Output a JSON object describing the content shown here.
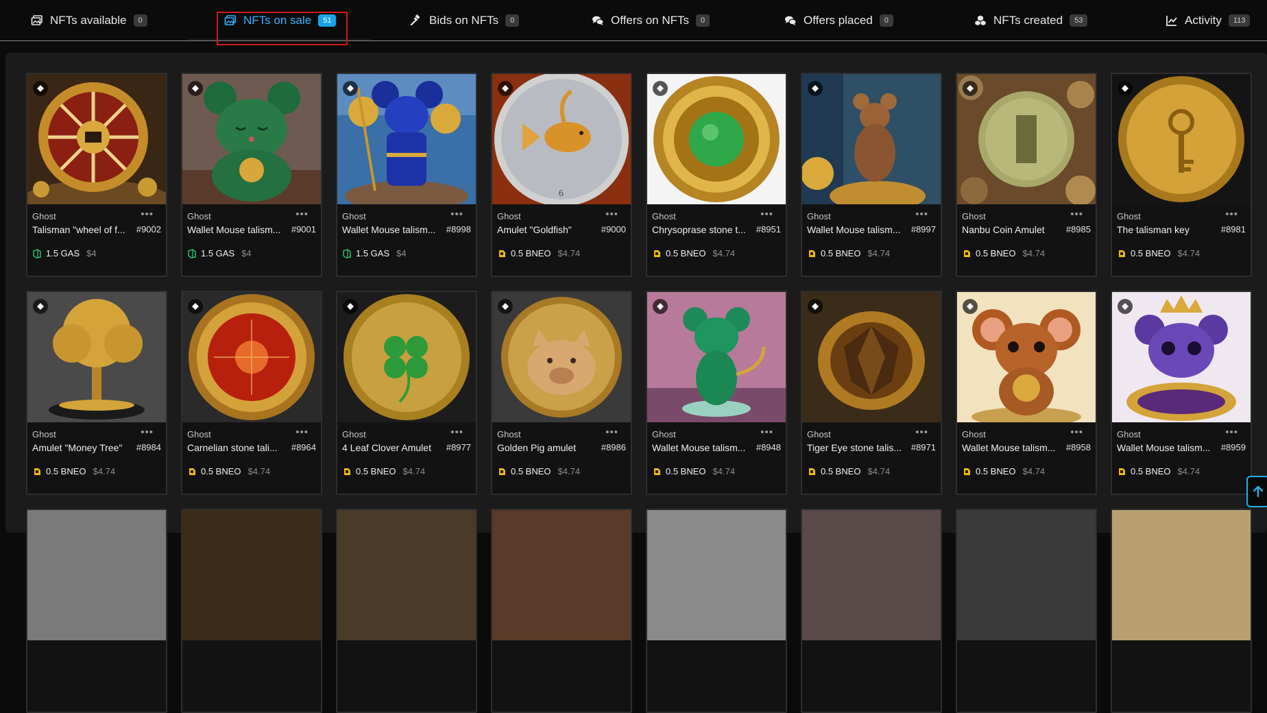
{
  "tabs": [
    {
      "label": "NFTs available",
      "count": "0",
      "icon": "images-icon",
      "active": false
    },
    {
      "label": "NFTs on sale",
      "count": "51",
      "icon": "images-icon",
      "active": true
    },
    {
      "label": "Bids on NFTs",
      "count": "0",
      "icon": "gavel-icon",
      "active": false
    },
    {
      "label": "Offers on NFTs",
      "count": "0",
      "icon": "chat-icon",
      "active": false
    },
    {
      "label": "Offers placed",
      "count": "0",
      "icon": "chat-icon",
      "active": false
    },
    {
      "label": "NFTs created",
      "count": "53",
      "icon": "cubes-icon",
      "active": false
    },
    {
      "label": "Activity",
      "count": "113",
      "icon": "chart-icon",
      "active": false
    }
  ],
  "colors": {
    "accent": "#2fb6ff",
    "highlight": "#d11a1a",
    "gas": "#2ecc71",
    "bneo": "#f0b90b"
  },
  "cards": [
    {
      "creator": "Ghost",
      "title": "Talisman \"wheel of f...",
      "number": "#9002",
      "price": "1.5 GAS",
      "usd": "$4",
      "currency": "GAS",
      "image": "roulette-coin"
    },
    {
      "creator": "Ghost",
      "title": "Wallet Mouse talism...",
      "number": "#9001",
      "price": "1.5 GAS",
      "usd": "$4",
      "currency": "GAS",
      "image": "green-mouse"
    },
    {
      "creator": "Ghost",
      "title": "Wallet Mouse talism...",
      "number": "#8998",
      "price": "1.5 GAS",
      "usd": "$4",
      "currency": "GAS",
      "image": "blue-mouse"
    },
    {
      "creator": "Ghost",
      "title": "Amulet \"Goldfish\"",
      "number": "#9000",
      "price": "0.5 BNEO",
      "usd": "$4.74",
      "currency": "BNEO",
      "image": "goldfish-coin"
    },
    {
      "creator": "Ghost",
      "title": "Chrysoprase stone t...",
      "number": "#8951",
      "price": "0.5 BNEO",
      "usd": "$4.74",
      "currency": "BNEO",
      "image": "green-stone-coin"
    },
    {
      "creator": "Ghost",
      "title": "Wallet Mouse talism...",
      "number": "#8997",
      "price": "0.5 BNEO",
      "usd": "$4.74",
      "currency": "BNEO",
      "image": "brown-mouse-coin"
    },
    {
      "creator": "Ghost",
      "title": "Nanbu Coin Amulet",
      "number": "#8985",
      "price": "0.5 BNEO",
      "usd": "$4.74",
      "currency": "BNEO",
      "image": "nanbu-coin"
    },
    {
      "creator": "Ghost",
      "title": "The talisman key",
      "number": "#8981",
      "price": "0.5 BNEO",
      "usd": "$4.74",
      "currency": "BNEO",
      "image": "key-coin"
    },
    {
      "creator": "Ghost",
      "title": "Amulet \"Money Tree\"",
      "number": "#8984",
      "price": "0.5 BNEO",
      "usd": "$4.74",
      "currency": "BNEO",
      "image": "money-tree"
    },
    {
      "creator": "Ghost",
      "title": "Carnelian stone tali...",
      "number": "#8964",
      "price": "0.5 BNEO",
      "usd": "$4.74",
      "currency": "BNEO",
      "image": "red-stone-coin"
    },
    {
      "creator": "Ghost",
      "title": "4 Leaf Clover Amulet",
      "number": "#8977",
      "price": "0.5 BNEO",
      "usd": "$4.74",
      "currency": "BNEO",
      "image": "clover-coin"
    },
    {
      "creator": "Ghost",
      "title": "Golden Pig amulet",
      "number": "#8986",
      "price": "0.5 BNEO",
      "usd": "$4.74",
      "currency": "BNEO",
      "image": "pig-coin"
    },
    {
      "creator": "Ghost",
      "title": "Wallet Mouse talism...",
      "number": "#8948",
      "price": "0.5 BNEO",
      "usd": "$4.74",
      "currency": "BNEO",
      "image": "green-mouse-figure"
    },
    {
      "creator": "Ghost",
      "title": "Tiger Eye stone talis...",
      "number": "#8971",
      "price": "0.5 BNEO",
      "usd": "$4.74",
      "currency": "BNEO",
      "image": "tiger-eye-ring"
    },
    {
      "creator": "Ghost",
      "title": "Wallet Mouse talism...",
      "number": "#8958",
      "price": "0.5 BNEO",
      "usd": "$4.74",
      "currency": "BNEO",
      "image": "cute-mouse-coin"
    },
    {
      "creator": "Ghost",
      "title": "Wallet Mouse talism...",
      "number": "#8959",
      "price": "0.5 BNEO",
      "usd": "$4.74",
      "currency": "BNEO",
      "image": "purple-mouse-crown"
    }
  ]
}
